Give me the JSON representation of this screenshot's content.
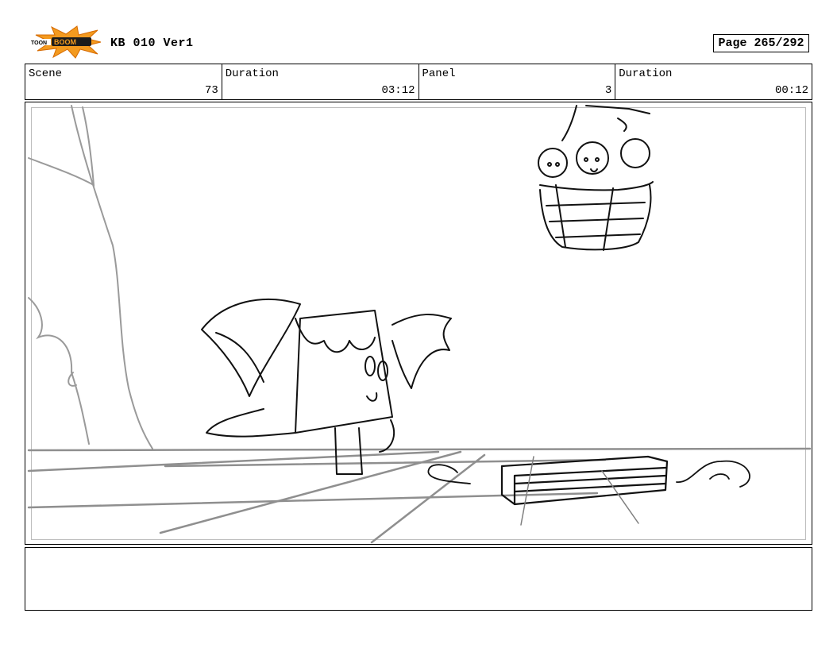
{
  "header": {
    "logo_text": "TOON BOOM",
    "doc_title": "KB 010 Ver1",
    "page_label": "Page 265/292"
  },
  "info": {
    "scene_label": "Scene",
    "scene_value": "73",
    "scene_duration_label": "Duration",
    "scene_duration_value": "03:12",
    "panel_label": "Panel",
    "panel_value": "3",
    "panel_duration_label": "Duration",
    "panel_duration_value": "00:12"
  },
  "notes": {
    "text": ""
  }
}
